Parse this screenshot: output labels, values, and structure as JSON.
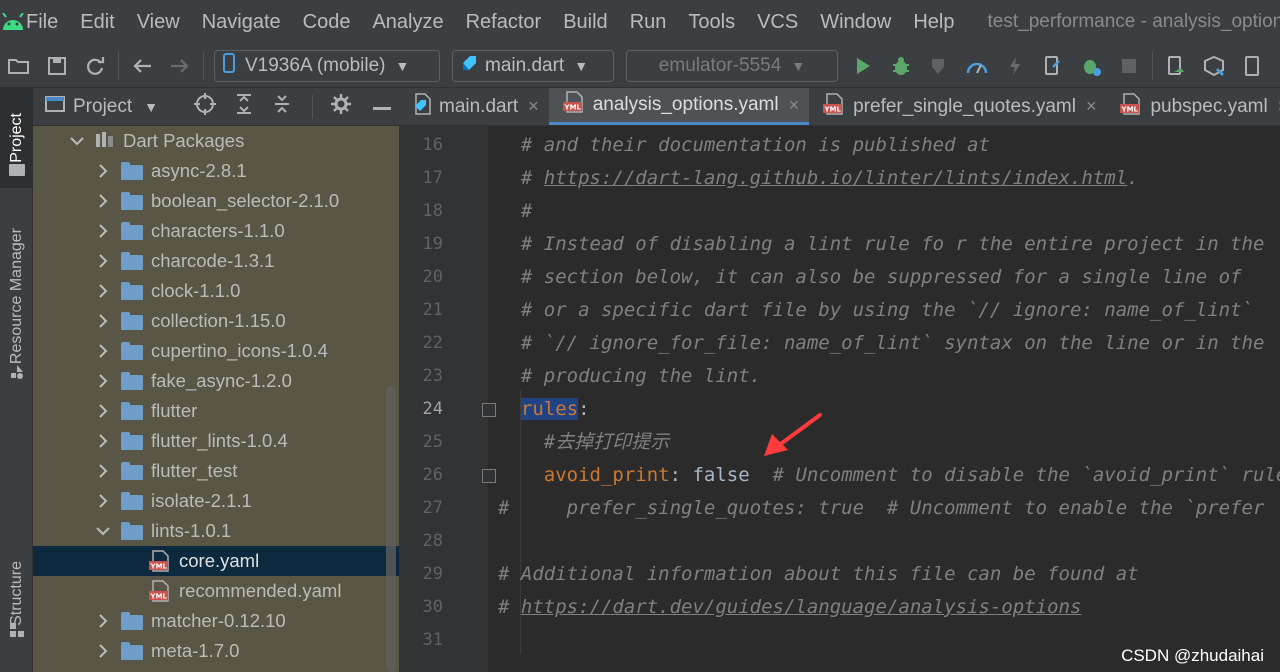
{
  "menubar": {
    "items": [
      "File",
      "Edit",
      "View",
      "Navigate",
      "Code",
      "Analyze",
      "Refactor",
      "Build",
      "Run",
      "Tools",
      "VCS",
      "Window",
      "Help"
    ],
    "window_title": "test_performance - analysis_options.ya"
  },
  "toolbar": {
    "device_combo": "V1936A (mobile)",
    "run_config_combo": "main.dart",
    "emulator_combo": "emulator-5554"
  },
  "left_strip": {
    "project_tab": "Project",
    "resource_manager_tab": "Resource Manager",
    "structure_tab": "Structure"
  },
  "project_panel": {
    "title": "Project",
    "tree": [
      {
        "label": "Dart Packages",
        "kind": "library",
        "expanded": true
      },
      {
        "label": "async-2.8.1",
        "kind": "folder",
        "expanded": false
      },
      {
        "label": "boolean_selector-2.1.0",
        "kind": "folder",
        "expanded": false
      },
      {
        "label": "characters-1.1.0",
        "kind": "folder",
        "expanded": false
      },
      {
        "label": "charcode-1.3.1",
        "kind": "folder",
        "expanded": false
      },
      {
        "label": "clock-1.1.0",
        "kind": "folder",
        "expanded": false
      },
      {
        "label": "collection-1.15.0",
        "kind": "folder",
        "expanded": false
      },
      {
        "label": "cupertino_icons-1.0.4",
        "kind": "folder",
        "expanded": false
      },
      {
        "label": "fake_async-1.2.0",
        "kind": "folder",
        "expanded": false
      },
      {
        "label": "flutter",
        "kind": "folder",
        "expanded": false
      },
      {
        "label": "flutter_lints-1.0.4",
        "kind": "folder",
        "expanded": false
      },
      {
        "label": "flutter_test",
        "kind": "folder",
        "expanded": false
      },
      {
        "label": "isolate-2.1.1",
        "kind": "folder",
        "expanded": false
      },
      {
        "label": "lints-1.0.1",
        "kind": "folder",
        "expanded": true
      },
      {
        "label": "core.yaml",
        "kind": "yaml",
        "selected": true
      },
      {
        "label": "recommended.yaml",
        "kind": "yaml"
      },
      {
        "label": "matcher-0.12.10",
        "kind": "folder",
        "expanded": false
      },
      {
        "label": "meta-1.7.0",
        "kind": "folder",
        "expanded": false
      }
    ]
  },
  "tabs": [
    {
      "label": "main.dart",
      "kind": "dart",
      "active": false
    },
    {
      "label": "analysis_options.yaml",
      "kind": "yaml",
      "active": true
    },
    {
      "label": "prefer_single_quotes.yaml",
      "kind": "yaml",
      "active": false
    },
    {
      "label": "pubspec.yaml",
      "kind": "yaml",
      "active": false
    }
  ],
  "editor": {
    "current_line": 24,
    "lines": [
      {
        "n": 16,
        "segments": [
          {
            "t": "  # and their documentation is published at",
            "c": "comment"
          }
        ]
      },
      {
        "n": 17,
        "segments": [
          {
            "t": "  # ",
            "c": "comment"
          },
          {
            "t": "https://dart-lang.github.io/linter/lints/index.html",
            "c": "comment link"
          },
          {
            "t": ".",
            "c": "comment"
          }
        ]
      },
      {
        "n": 18,
        "segments": [
          {
            "t": "  #",
            "c": "comment"
          }
        ]
      },
      {
        "n": 19,
        "segments": [
          {
            "t": "  # Instead of disabling a lint rule fo r the entire project in the",
            "c": "comment"
          }
        ]
      },
      {
        "n": 20,
        "segments": [
          {
            "t": "  # section below, it can also be suppressed for a single line of",
            "c": "comment"
          }
        ]
      },
      {
        "n": 21,
        "segments": [
          {
            "t": "  # or a specific dart file by using the `// ignore: name_of_lint`",
            "c": "comment"
          }
        ]
      },
      {
        "n": 22,
        "segments": [
          {
            "t": "  # `// ignore_for_file: name_of_lint` syntax on the line or in the",
            "c": "comment"
          }
        ]
      },
      {
        "n": 23,
        "segments": [
          {
            "t": "  # producing the lint.",
            "c": "comment"
          }
        ]
      },
      {
        "n": 24,
        "segments": [
          {
            "t": "  ",
            "c": "plain"
          },
          {
            "t": "rules",
            "c": "keyhl"
          },
          {
            "t": ":",
            "c": "plain"
          }
        ]
      },
      {
        "n": 25,
        "segments": [
          {
            "t": "    #去掉打印提示",
            "c": "comment"
          }
        ]
      },
      {
        "n": 26,
        "segments": [
          {
            "t": "    ",
            "c": "plain"
          },
          {
            "t": "avoid_print",
            "c": "key"
          },
          {
            "t": ": false  ",
            "c": "plain"
          },
          {
            "t": "# Uncomment to disable the `avoid_print` rule",
            "c": "comment"
          }
        ]
      },
      {
        "n": 27,
        "segments": [
          {
            "t": "#     prefer_single_quotes: true  # Uncomment to enable the `prefer",
            "c": "comment"
          }
        ]
      },
      {
        "n": 28,
        "segments": []
      },
      {
        "n": 29,
        "segments": [
          {
            "t": "# Additional information about this file can be found at",
            "c": "comment"
          }
        ]
      },
      {
        "n": 30,
        "segments": [
          {
            "t": "# ",
            "c": "comment"
          },
          {
            "t": "https://dart.dev/guides/language/analysis-options",
            "c": "comment link"
          }
        ]
      },
      {
        "n": 31,
        "segments": []
      }
    ]
  },
  "watermark": "CSDN @zhudaihai",
  "colors": {
    "accent": "#4a88c7",
    "selection": "#214283",
    "comment": "#808080",
    "keyword": "#cc7832",
    "annotation_arrow": "#ff3b3b"
  }
}
